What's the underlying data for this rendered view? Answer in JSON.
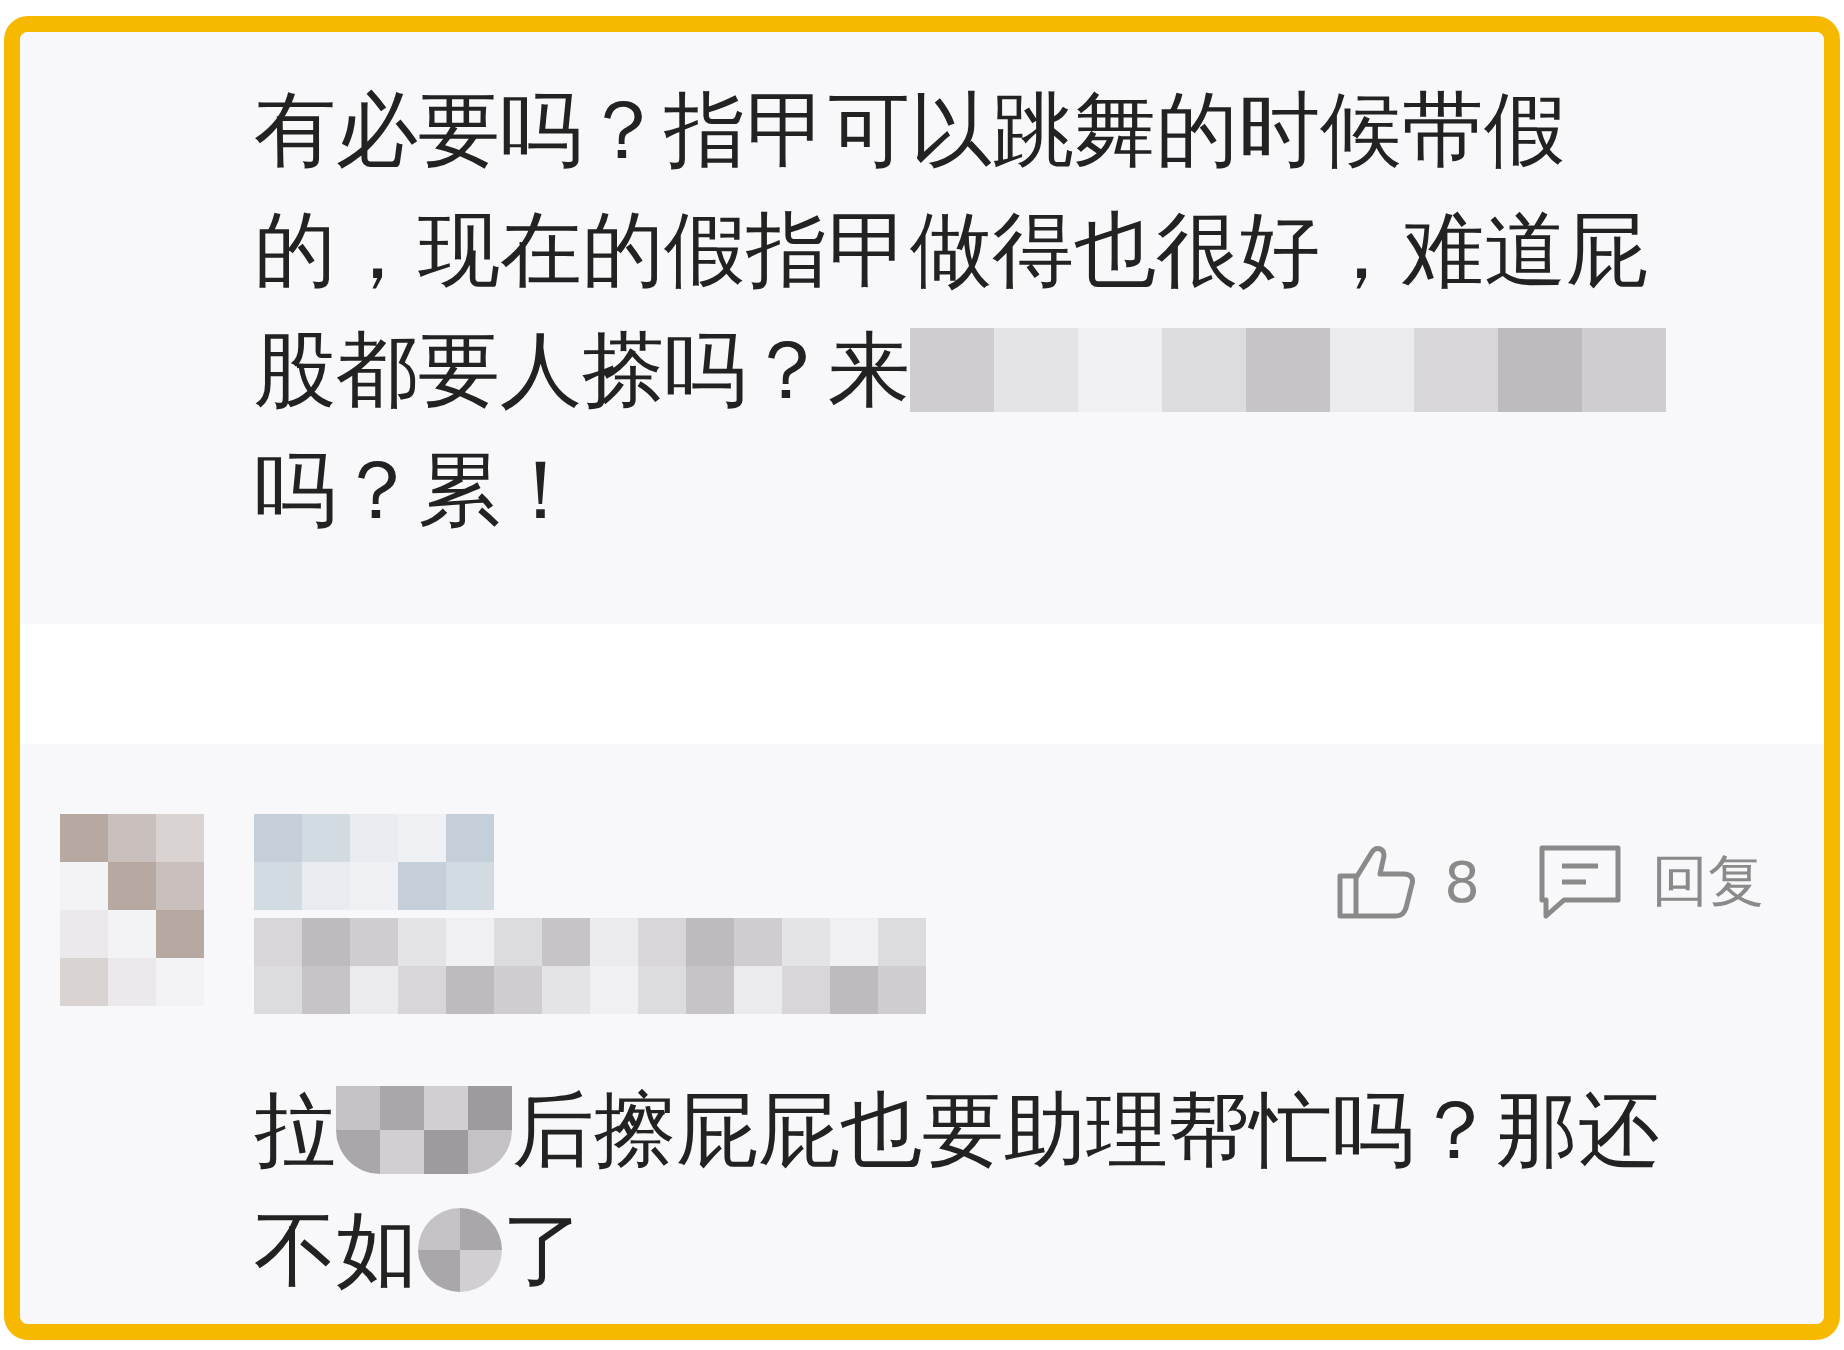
{
  "comments": [
    {
      "lines": [
        [
          {
            "kind": "text",
            "text": "有必要吗？指甲可以跳舞的时候带假"
          }
        ],
        [
          {
            "kind": "text",
            "text": "的，现在的假指甲做得也很好，难道屁"
          }
        ],
        [
          {
            "kind": "text",
            "text": "股都要人搽吗？来"
          },
          {
            "kind": "bar"
          }
        ],
        [
          {
            "kind": "text",
            "text": "吗？累！"
          }
        ]
      ]
    },
    {
      "header": {
        "likes": "8",
        "reply": "回复"
      },
      "lines": [
        [
          {
            "kind": "text",
            "text": "拉"
          },
          {
            "kind": "patch"
          },
          {
            "kind": "text",
            "text": "后擦屁屁也要助理帮忙吗？那还"
          }
        ],
        [
          {
            "kind": "text",
            "text": "不如"
          },
          {
            "kind": "dot"
          },
          {
            "kind": "text",
            "text": "了"
          }
        ]
      ]
    }
  ]
}
